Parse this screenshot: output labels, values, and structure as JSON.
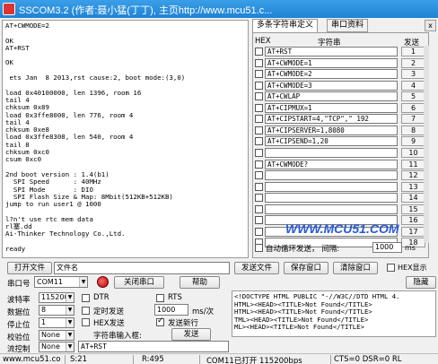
{
  "window": {
    "title": "SSCOM3.2 (作者:聂小猛(丁丁), 主页http://www.mcu51.c..."
  },
  "receive": {
    "lines": [
      "AT+CWMODE=2",
      "",
      "OK",
      "AT+RST",
      "",
      "OK",
      "",
      " ets Jan  8 2013,rst cause:2, boot mode:(3,0)",
      "",
      "load 0x40100000, len 1396, room 16",
      "tail 4",
      "chksum 0x89",
      "load 0x3ffe8000, len 776, room 4",
      "tail 4",
      "chksum 0xe8",
      "load 0x3ffe8308, len 540, room 4",
      "tail 8",
      "chksum 0xc0",
      "csum 0xc0",
      "",
      "2nd boot version : 1.4(b1)",
      "  SPI Speed      : 40MHz",
      "  SPI Mode       : DIO",
      "  SPI Flash Size & Map: 8Mbit(512KB+512KB)",
      "jump to run user1 @ 1000",
      "",
      "l?n't use rtc mem data",
      "rl塞.dd",
      "Ai-Thinker Technology Co.,Ltd.",
      "",
      "ready"
    ]
  },
  "tabs": [
    {
      "label": "多条字符串定义"
    },
    {
      "label": "串口资料"
    }
  ],
  "close_glyph": "x",
  "multi_string": {
    "header_hex": "HEX",
    "header_string": "字符串",
    "header_send": "发送",
    "rows": [
      {
        "cmd": "AT+RST",
        "num": "1"
      },
      {
        "cmd": "AT+CWMODE=1",
        "num": "2"
      },
      {
        "cmd": "AT+CWMODE=2",
        "num": "3"
      },
      {
        "cmd": "AT+CWMODE=3",
        "num": "4"
      },
      {
        "cmd": "AT+CWLAP",
        "num": "5"
      },
      {
        "cmd": "AT+CIPMUX=1",
        "num": "6"
      },
      {
        "cmd": "AT+CIPSTART=4,\"TCP\",\" 192",
        "num": "7"
      },
      {
        "cmd": "AT+CIPSERVER=1,8080",
        "num": "8"
      },
      {
        "cmd": "AT+CIPSEND=1,20",
        "num": "9"
      },
      {
        "cmd": "",
        "num": "10"
      },
      {
        "cmd": "AT+CWMODE?",
        "num": "11"
      },
      {
        "cmd": "",
        "num": "12"
      },
      {
        "cmd": "",
        "num": "13"
      },
      {
        "cmd": "",
        "num": "14"
      },
      {
        "cmd": "",
        "num": "15"
      },
      {
        "cmd": "",
        "num": "16"
      },
      {
        "cmd": "",
        "num": "17"
      },
      {
        "cmd": "",
        "num": "18"
      }
    ],
    "loop_label": "自动循环发送，  间隔:",
    "interval_value": "1000",
    "interval_unit": "ms"
  },
  "watermark": "WWW.MCU51.COM",
  "row_file": {
    "open_file": "打开文件",
    "file_name": "文件名",
    "send_file": "发送文件",
    "save_window": "保存窗口",
    "clear_window": "清除窗口",
    "hex_display": "HEX显示"
  },
  "row_port": {
    "port_label": "串口号",
    "port_value": "COM11",
    "close_port": "关闭串口",
    "help": "帮助",
    "hide": "隐藏"
  },
  "settings": {
    "baud_label": "波特率",
    "baud_value": "115200",
    "data_label": "数据位",
    "data_value": "8",
    "stop_label": "停止位",
    "stop_value": "1",
    "parity_label": "校验位",
    "parity_value": "None",
    "flow_label": "流控制",
    "flow_value": "None",
    "dtr": "DTR",
    "rts": "RTS",
    "timed_send": "定时发送",
    "period_value": "1000",
    "period_unit": "ms/次",
    "hex_send": "HEX发送",
    "send_newline": "发送新行",
    "input_label": "字符串输入框:",
    "send_button": "发送",
    "input_value": "AT+RST"
  },
  "banner": {
    "lines": [
      "<!DOCTYPE HTML PUBLIC \"-//W3C//DTD HTML 4.",
      "HTML><HEAD><TITLE>Not Found</TITLE>",
      "HTML><HEAD><TITLE>Not Found</TITLE>",
      "TML><HEAD><TITLE>Not Found</TITLE>",
      "ML><HEAD><TITLE>Not Found</TITLE>"
    ]
  },
  "status": {
    "site": "www.mcu51.co",
    "s": "S:21",
    "r": "R:495",
    "port_state": "COM11已打开  115200bps",
    "lines": "CTS=0 DSR=0 RL"
  }
}
